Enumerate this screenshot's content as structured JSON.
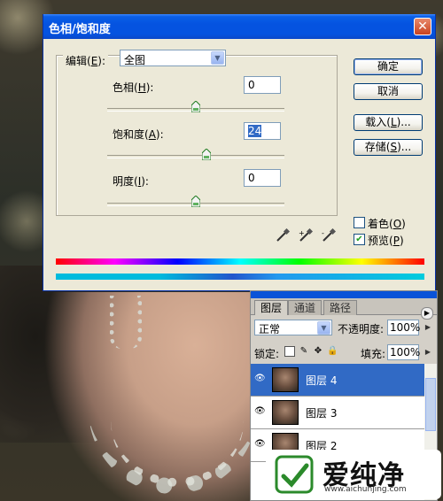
{
  "dialog": {
    "title": "色相/饱和度",
    "close_glyph": "✕",
    "edit": {
      "label": "编辑(",
      "key": "E",
      "suffix": "):",
      "value": "全图"
    },
    "hue": {
      "label": "色相(",
      "key": "H",
      "suffix": "):",
      "value": "0",
      "slider_fraction": 0.5
    },
    "saturation": {
      "label": "饱和度(",
      "key": "A",
      "suffix": "):",
      "value": "24",
      "slider_fraction": 0.562
    },
    "lightness": {
      "label": "明度(",
      "key": "I",
      "suffix": "):",
      "value": "0",
      "slider_fraction": 0.5
    },
    "buttons": {
      "ok": "确定",
      "cancel": "取消",
      "load": {
        "label": "载入(",
        "key": "L",
        "suffix": ")..."
      },
      "save": {
        "label": "存储(",
        "key": "S",
        "suffix": ")..."
      }
    },
    "colorize": {
      "label": "着色(",
      "key": "O",
      "suffix": ")",
      "checked": false
    },
    "preview": {
      "label": "预览(",
      "key": "P",
      "suffix": ")",
      "checked": true
    }
  },
  "layers_panel": {
    "tabs": [
      "图层",
      "通道",
      "路径"
    ],
    "blend_mode": "正常",
    "opacity_label": "不透明度:",
    "opacity_value": "100%",
    "lock_label": "锁定:",
    "fill_label": "填充:",
    "fill_value": "100%",
    "layers": [
      {
        "name": "图层 4",
        "selected": true
      },
      {
        "name": "图层 3",
        "selected": false
      },
      {
        "name": "图层 2",
        "selected": false
      }
    ]
  },
  "watermark": {
    "text": "爱纯净",
    "url": "www.aichunjing.com"
  },
  "colors": {
    "titlebar": "#0553e0",
    "dialog_bg": "#ece9d8",
    "selection": "#316ac5",
    "close": "#c8421f"
  }
}
